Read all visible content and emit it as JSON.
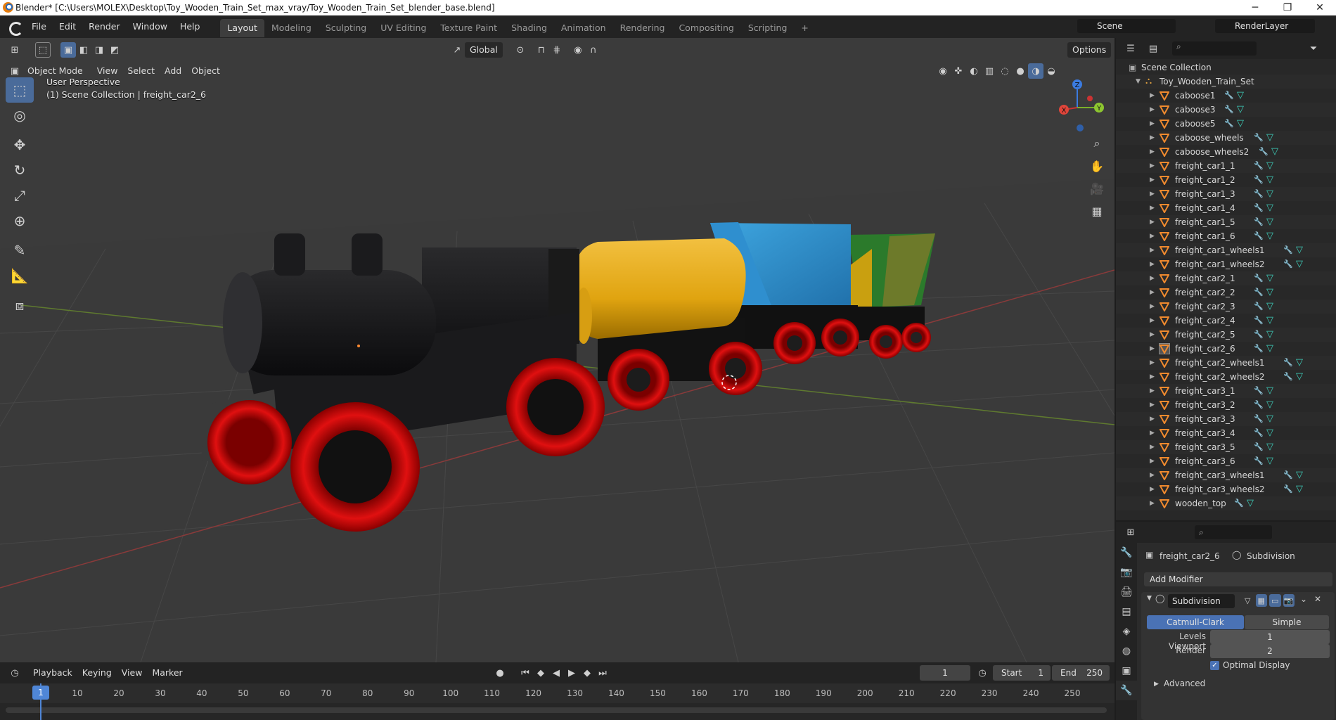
{
  "window": {
    "title": "Blender* [C:\\Users\\MOLEX\\Desktop\\Toy_Wooden_Train_Set_max_vray/Toy_Wooden_Train_Set_blender_base.blend]",
    "minimize": "─",
    "maximize": "❐",
    "close": "✕"
  },
  "menu": [
    "File",
    "Edit",
    "Render",
    "Window",
    "Help"
  ],
  "workspaces": {
    "active": "Layout",
    "tabs": [
      "Layout",
      "Modeling",
      "Sculpting",
      "UV Editing",
      "Texture Paint",
      "Shading",
      "Animation",
      "Rendering",
      "Compositing",
      "Scripting"
    ],
    "add": "+"
  },
  "scene": {
    "name": "Scene",
    "view_layer": "RenderLayer"
  },
  "viewport_header": {
    "orientation": "Global",
    "options": "Options",
    "mode": "Object Mode",
    "menus": [
      "View",
      "Select",
      "Add",
      "Object"
    ]
  },
  "viewport_info": {
    "perspective": "User Perspective",
    "collection": "(1) Scene Collection | freight_car2_6"
  },
  "gizmo": {
    "x": "X",
    "y": "Y",
    "z": "Z"
  },
  "outliner": {
    "root": "Scene Collection",
    "collection": "Toy_Wooden_Train_Set",
    "selected": "freight_car2_6",
    "items": [
      "caboose1",
      "caboose3",
      "caboose5",
      "caboose_wheels",
      "caboose_wheels2",
      "freight_car1_1",
      "freight_car1_2",
      "freight_car1_3",
      "freight_car1_4",
      "freight_car1_5",
      "freight_car1_6",
      "freight_car1_wheels1",
      "freight_car1_wheels2",
      "freight_car2_1",
      "freight_car2_2",
      "freight_car2_3",
      "freight_car2_4",
      "freight_car2_5",
      "freight_car2_6",
      "freight_car2_wheels1",
      "freight_car2_wheels2",
      "freight_car3_1",
      "freight_car3_2",
      "freight_car3_3",
      "freight_car3_4",
      "freight_car3_5",
      "freight_car3_6",
      "freight_car3_wheels1",
      "freight_car3_wheels2",
      "wooden_top"
    ]
  },
  "properties": {
    "object": "freight_car2_6",
    "modifier_breadcrumb": "Subdivision",
    "add_modifier": "Add Modifier",
    "modifier": {
      "name": "Subdivision",
      "types": [
        "Catmull-Clark",
        "Simple"
      ],
      "active_type": "Catmull-Clark",
      "levels_viewport_label": "Levels Viewport",
      "levels_viewport": "1",
      "render_label": "Render",
      "render": "2",
      "optimal_display_label": "Optimal Display",
      "optimal_display": true,
      "advanced": "Advanced"
    }
  },
  "timeline": {
    "menus": [
      "Playback",
      "Keying",
      "View",
      "Marker"
    ],
    "current_frame": "1",
    "start_label": "Start",
    "start": "1",
    "end_label": "End",
    "end": "250",
    "ticks": [
      "1",
      "10",
      "20",
      "30",
      "40",
      "50",
      "60",
      "70",
      "80",
      "90",
      "100",
      "110",
      "120",
      "130",
      "140",
      "150",
      "160",
      "170",
      "180",
      "190",
      "200",
      "210",
      "220",
      "230",
      "240",
      "250"
    ]
  }
}
